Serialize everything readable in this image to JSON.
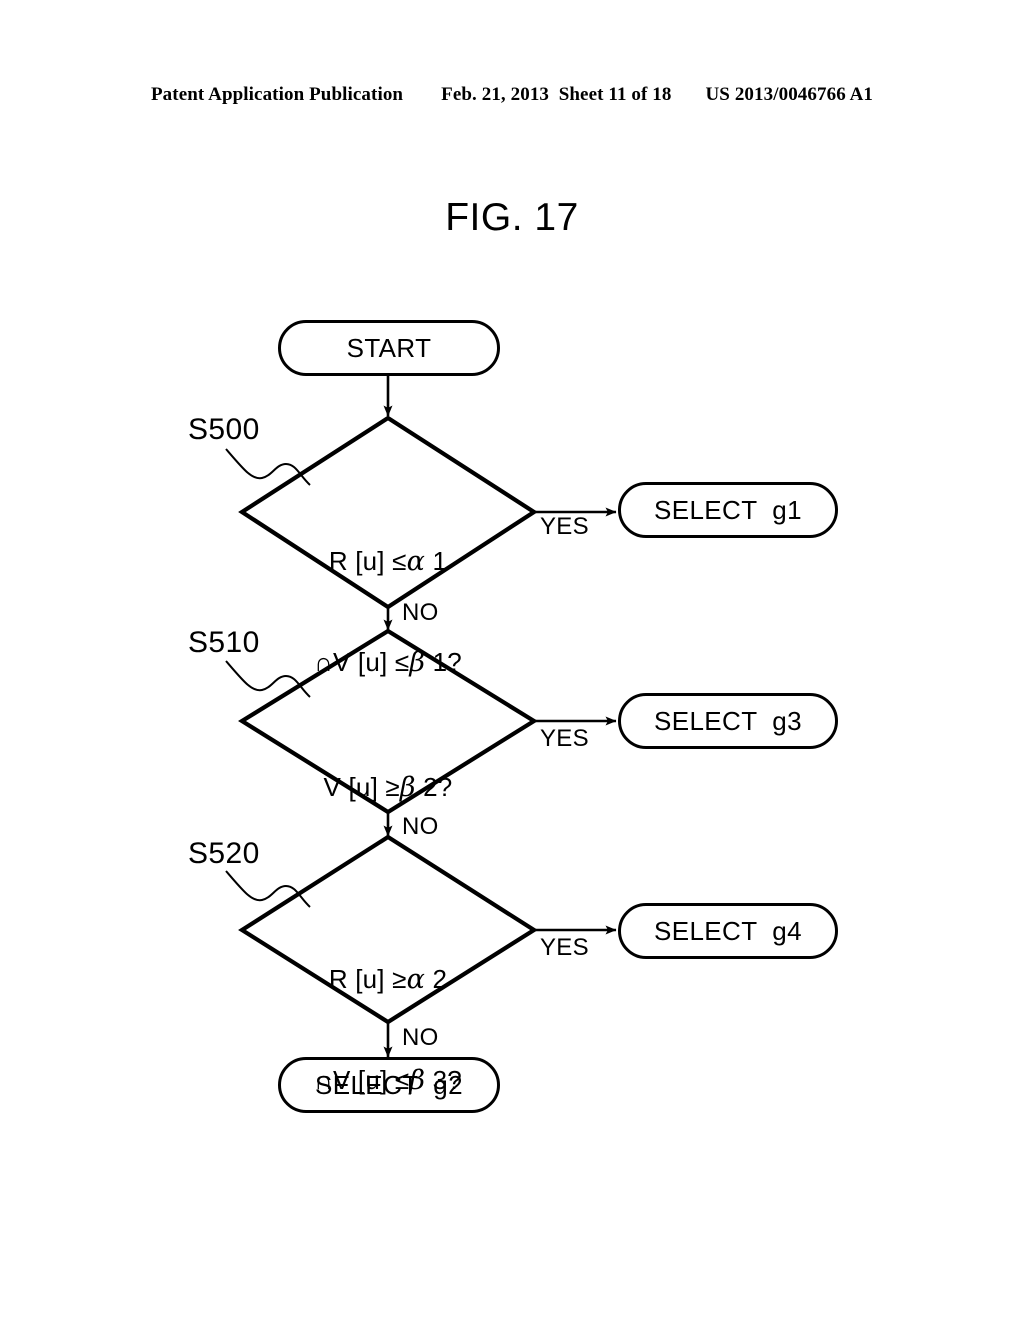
{
  "header": {
    "publication": "Patent Application Publication",
    "date_sheet": "Feb. 21, 2013  Sheet 11 of 18",
    "patent_number": "US 2013/0046766 A1"
  },
  "figure": {
    "title": "FIG. 17"
  },
  "flowchart": {
    "start_node": {
      "label": "START"
    },
    "steps": [
      {
        "id": "S500",
        "step_label": "S500",
        "condition_line1_prefix": "R [u] ",
        "condition_line1_op": "≤",
        "condition_line1_greek": "α",
        "condition_line1_suffix": " 1",
        "condition_line2_prefix": "∩V [u] ",
        "condition_line2_op": "≤",
        "condition_line2_greek": "β",
        "condition_line2_suffix": " 1?",
        "yes_label": "YES",
        "no_label": "NO",
        "yes_target": "SELECT  g1"
      },
      {
        "id": "S510",
        "step_label": "S510",
        "condition_line1_prefix": "V [u] ",
        "condition_line1_op": "≥",
        "condition_line1_greek": "β",
        "condition_line1_suffix": " 2?",
        "condition_line2_prefix": "",
        "condition_line2_op": "",
        "condition_line2_greek": "",
        "condition_line2_suffix": "",
        "yes_label": "YES",
        "no_label": "NO",
        "yes_target": "SELECT  g3"
      },
      {
        "id": "S520",
        "step_label": "S520",
        "condition_line1_prefix": "R [u] ",
        "condition_line1_op": "≥",
        "condition_line1_greek": "α",
        "condition_line1_suffix": " 2",
        "condition_line2_prefix": "∩V [u] ",
        "condition_line2_op": "≤",
        "condition_line2_greek": "β",
        "condition_line2_suffix": " 3?",
        "yes_label": "YES",
        "no_label": "NO",
        "yes_target": "SELECT  g4"
      }
    ],
    "outcome_boxes": [
      {
        "label": "SELECT  g1"
      },
      {
        "label": "SELECT  g3"
      },
      {
        "label": "SELECT  g4"
      },
      {
        "label": "SELECT  g2"
      }
    ],
    "final_node": {
      "label": "SELECT  g2"
    },
    "colors": {
      "stroke": "#000000",
      "background": "#ffffff"
    }
  }
}
